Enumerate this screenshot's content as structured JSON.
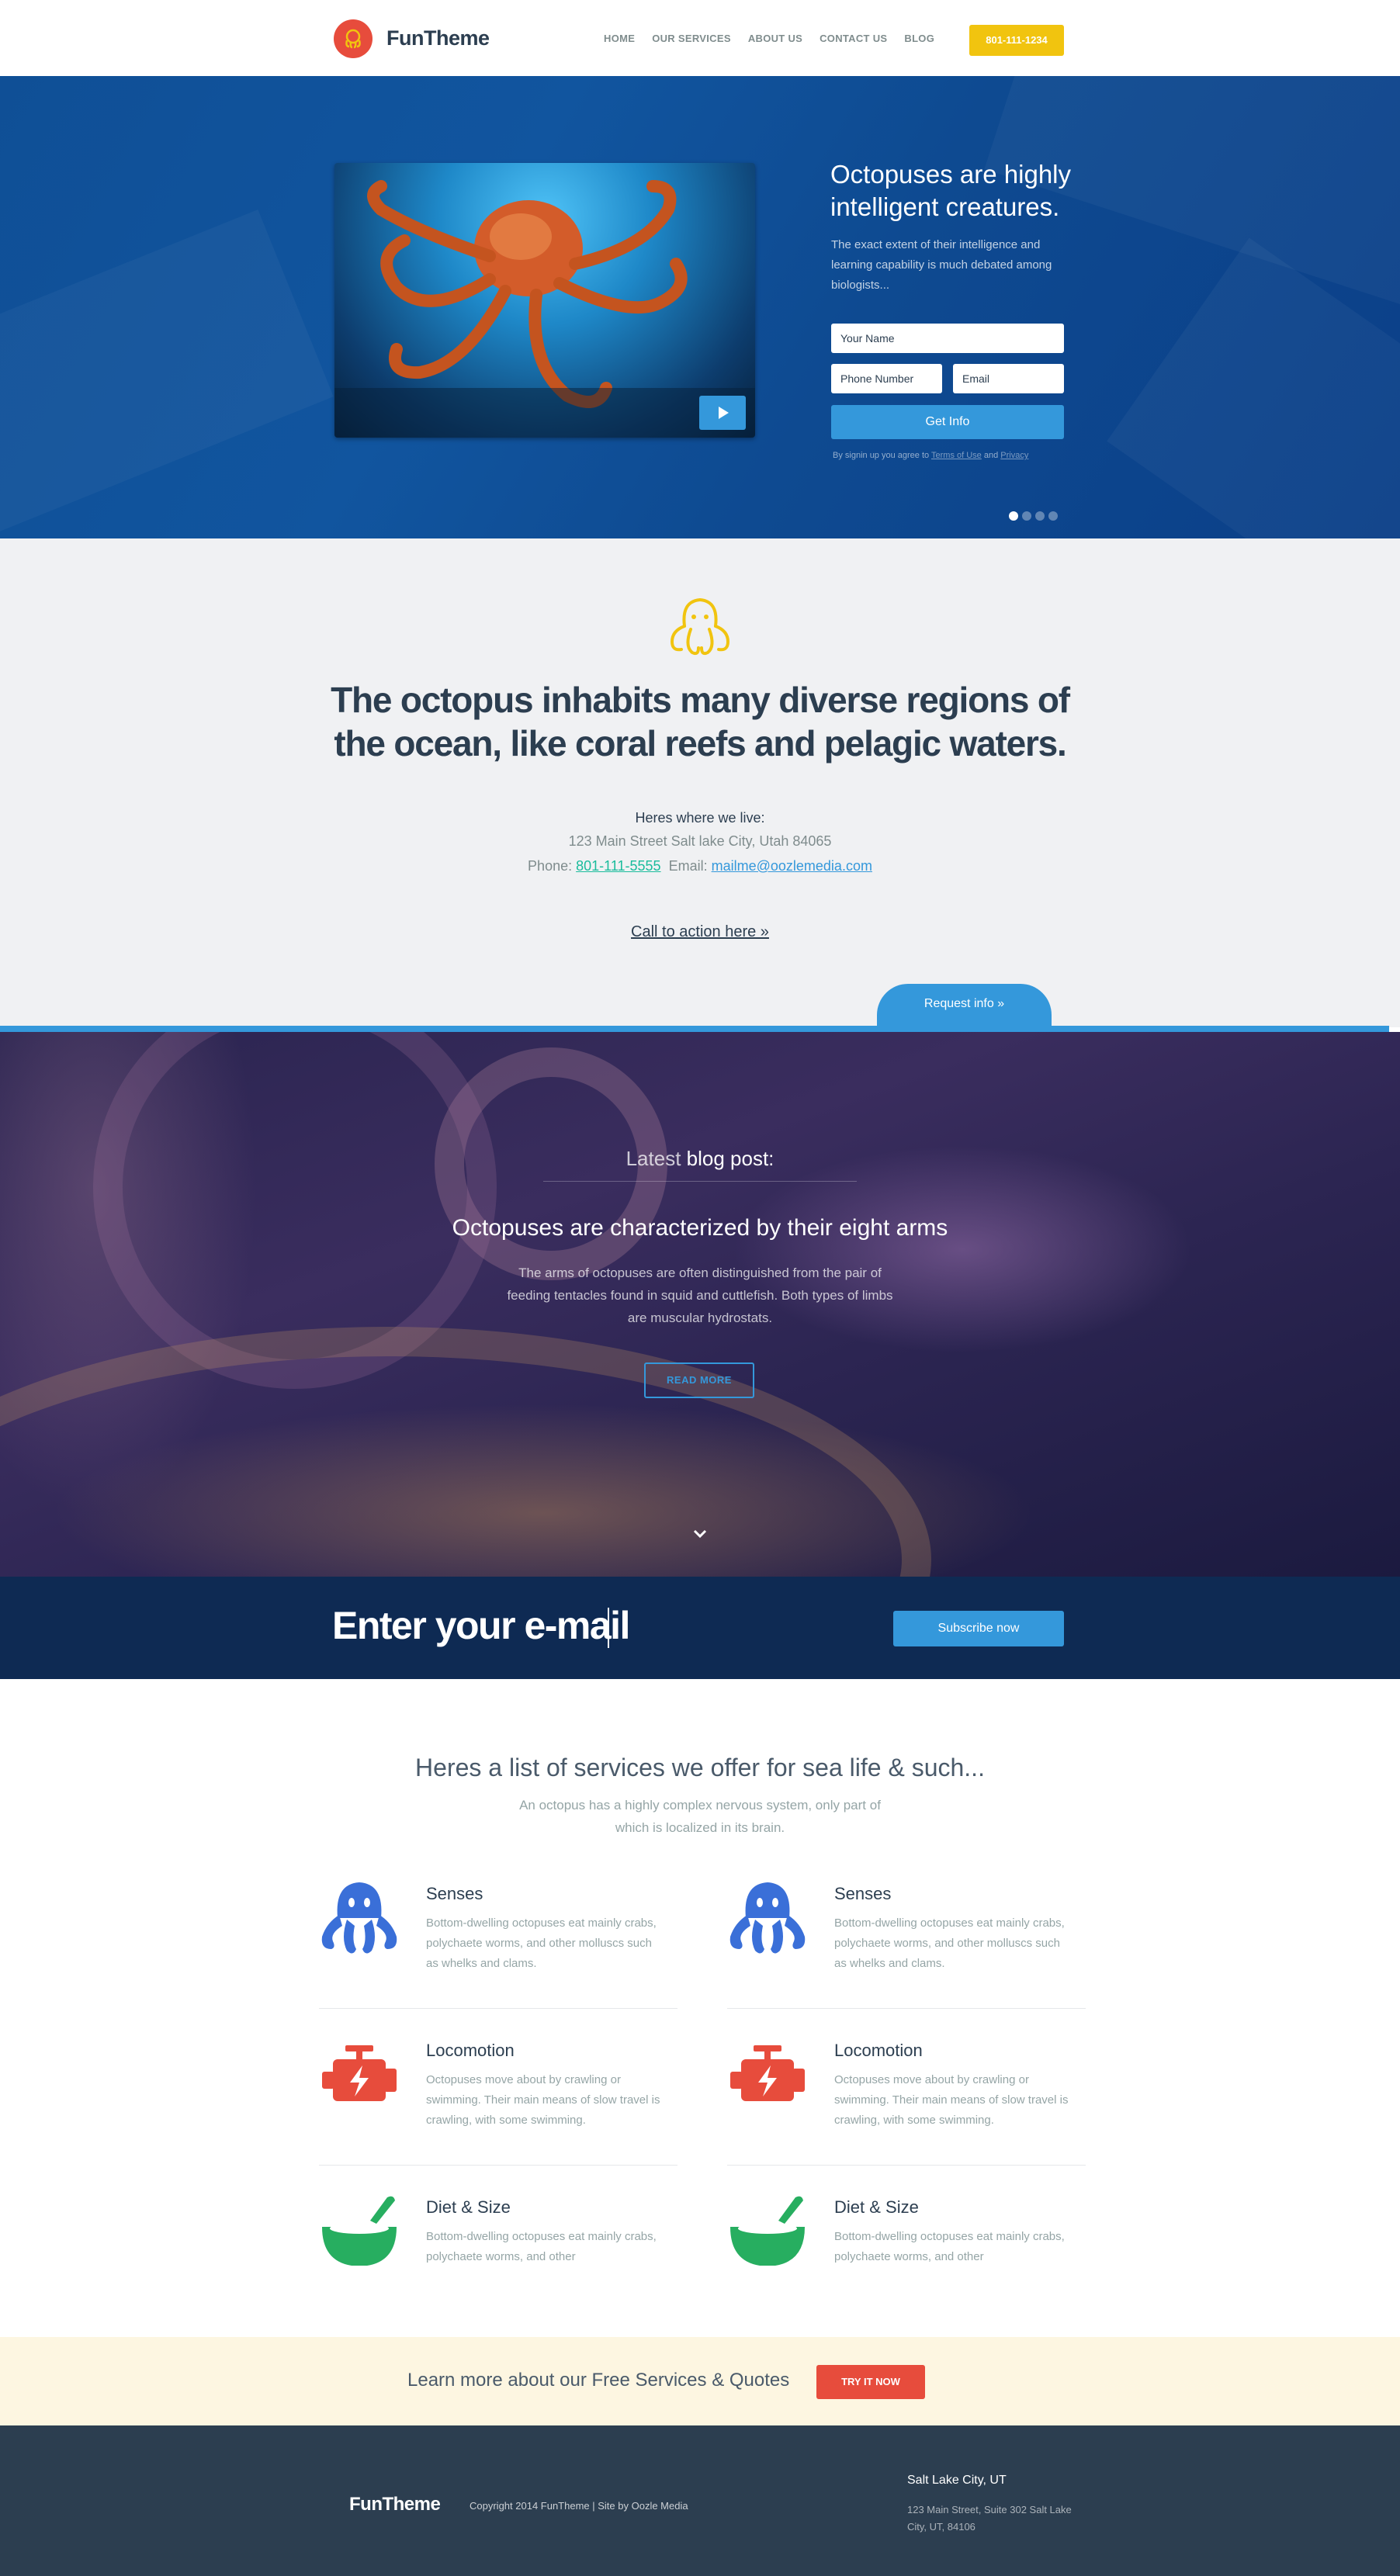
{
  "nav": {
    "brand": "FunTheme",
    "menu": [
      "HOME",
      "OUR SERVICES",
      "ABOUT US",
      "CONTACT US",
      "BLOG"
    ],
    "phone_button": "801-111-1234"
  },
  "hero": {
    "heading": "Octopuses are highly intelligent creatures.",
    "subtext": "The exact extent of their intelligence and learning capability is much debated among biologists...",
    "name_placeholder": "Your Name",
    "phone_placeholder": "Phone Number",
    "email_placeholder": "Email",
    "submit_label": "Get Info",
    "terms_prefix": "By signin up you agree to",
    "terms_link": "Terms of Use",
    "terms_and": "and",
    "privacy_link": "Privacy",
    "slide_count": 4,
    "active_slide": 1
  },
  "about": {
    "heading": "The octopus inhabits many diverse regions of the ocean, like coral reefs and pelagic waters.",
    "live_label": "Heres where we live:",
    "address": "123 Main Street Salt lake City, Utah 84065",
    "phone_label": "Phone:",
    "phone": "801-111-5555",
    "email_label": "Email:",
    "email": "mailme@oozlemedia.com",
    "cta": "Call to action here »",
    "request_tab": "Request info »"
  },
  "blog": {
    "latest_prefix": "Latest",
    "latest_bold": "blog post:",
    "title": "Octopuses are characterized by their eight arms",
    "excerpt": "The arms of octopuses are often distinguished from the pair of feeding tentacles found in squid and cuttlefish. Both types of limbs are muscular hydrostats.",
    "read_more": "READ MORE"
  },
  "subscribe": {
    "placeholder": "Enter your e-mail",
    "button": "Subscribe now"
  },
  "services": {
    "heading": "Heres a list of services we offer for sea life & such...",
    "intro": "An octopus has a highly complex nervous system, only part of which is localized in its brain.",
    "items": [
      {
        "icon": "octopus-icon",
        "title": "Senses",
        "text": "Bottom-dwelling octopuses eat mainly crabs, polychaete worms, and other molluscs such as whelks and clams."
      },
      {
        "icon": "octopus-icon",
        "title": "Senses",
        "text": "Bottom-dwelling octopuses eat mainly crabs, polychaete worms, and other molluscs such as whelks and clams."
      },
      {
        "icon": "engine-icon",
        "title": "Locomotion",
        "text": "Octopuses move about by crawling or swimming. Their main means of slow travel is crawling, with some swimming."
      },
      {
        "icon": "engine-icon",
        "title": "Locomotion",
        "text": "Octopuses move about by crawling or swimming. Their main means of slow travel is crawling, with some swimming."
      },
      {
        "icon": "mortar-pestle-icon",
        "title": "Diet & Size",
        "text": "Bottom-dwelling octopuses eat mainly crabs, polychaete worms, and other"
      },
      {
        "icon": "mortar-pestle-icon",
        "title": "Diet & Size",
        "text": "Bottom-dwelling octopuses eat mainly crabs, polychaete worms, and other"
      }
    ]
  },
  "band": {
    "text": "Learn more about our Free Services & Quotes",
    "button": "TRY IT NOW"
  },
  "footer": {
    "brand": "FunTheme",
    "copyright": "Copyright 2014 FunTheme | Site by Oozle Media",
    "city": "Salt Lake City, UT",
    "address": "123 Main Street, Suite 302 Salt Lake City, UT, 84106"
  },
  "colors": {
    "accent_blue": "#3498db",
    "brand_red": "#e74c3c",
    "brand_yellow": "#f1c40f",
    "service_blue": "#3a6fd8",
    "service_red": "#e74c3c",
    "service_green": "#27ae60",
    "dark_navy": "#0e2a53",
    "footer": "#2c3e50"
  }
}
